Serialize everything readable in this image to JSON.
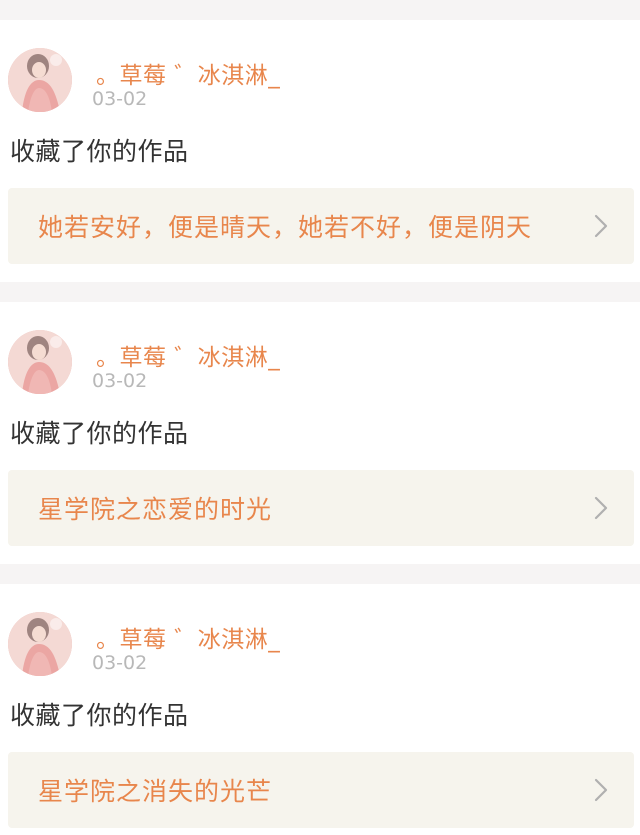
{
  "feed": {
    "items": [
      {
        "user_name": "。草莓 ゛冰淇淋_",
        "date": "03-02",
        "action": "收藏了你的作品",
        "work_title": "她若安好，便是晴天，她若不好，便是阴天"
      },
      {
        "user_name": "。草莓 ゛冰淇淋_",
        "date": "03-02",
        "action": "收藏了你的作品",
        "work_title": "星学院之恋爱的时光"
      },
      {
        "user_name": "。草莓 ゛冰淇淋_",
        "date": "03-02",
        "action": "收藏了你的作品",
        "work_title": "星学院之消失的光芒"
      }
    ]
  },
  "colors": {
    "accent": "#e8864c",
    "date": "#b8b8b8",
    "text": "#333333",
    "work_bg": "#f6f4ed",
    "page_bg": "#f6f4f4"
  },
  "icons": {
    "chevron": "chevron-right-icon",
    "avatar": "user-avatar"
  }
}
